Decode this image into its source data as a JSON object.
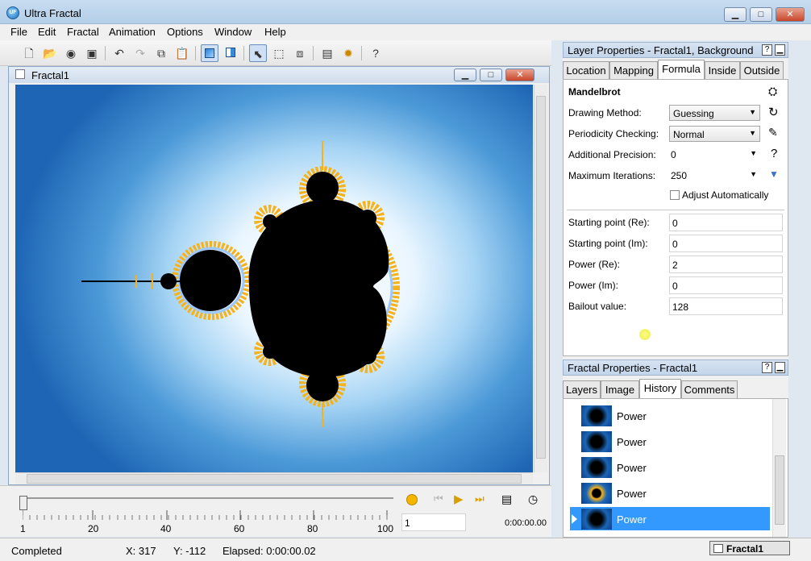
{
  "app": {
    "title": "Ultra Fractal"
  },
  "window_buttons": {
    "minimize": "▁",
    "maximize": "□",
    "close": "✕"
  },
  "menu": [
    "File",
    "Edit",
    "Fractal",
    "Animation",
    "Options",
    "Window",
    "Help"
  ],
  "toolbar": {
    "icons": [
      "new-file-icon",
      "open-folder-icon",
      "browse-icon",
      "save-icon",
      "undo-icon",
      "redo-icon",
      "copy-icon",
      "paste-icon",
      "fullscreen-view-icon",
      "split-view-icon",
      "select-tool-icon",
      "zoom-tool-icon",
      "move-tool-icon",
      "render-to-disk-icon",
      "gear-icon",
      "help-icon"
    ],
    "help_glyph": "?"
  },
  "document": {
    "title": "Fractal1"
  },
  "colors": {
    "accent": "#3399ff",
    "selected_row": "#3399ff",
    "fractal_inside": "#000000",
    "fractal_edge": "#f5b21b",
    "background_outer": "#1e66b5"
  },
  "animation": {
    "ticks": [
      "1",
      "20",
      "40",
      "60",
      "80",
      "100"
    ],
    "frame_value": "1",
    "time": "0:00:00.00"
  },
  "status": {
    "state": "Completed",
    "x_readout": "X: 317",
    "y_readout": "Y: -112",
    "elapsed": "Elapsed: 0:00:00.02",
    "taskbar_item": "Fractal1"
  },
  "layer_panel": {
    "title": "Layer Properties - Fractal1, Background",
    "tabs": [
      "Location",
      "Mapping",
      "Formula",
      "Inside",
      "Outside"
    ],
    "active_tab": "Formula",
    "formula_name": "Mandelbrot",
    "rows": [
      {
        "label": "Drawing Method:",
        "value": "Guessing"
      },
      {
        "label": "Periodicity Checking:",
        "value": "Normal"
      },
      {
        "label": "Additional Precision:",
        "value": "0"
      },
      {
        "label": "Maximum Iterations:",
        "value": "250"
      }
    ],
    "adjust_label": "Adjust Automatically",
    "help_glyph": "?",
    "params": [
      {
        "label": "Starting point (Re):",
        "value": "0"
      },
      {
        "label": "Starting point (Im):",
        "value": "0"
      },
      {
        "label": "Power (Re):",
        "value": "2"
      },
      {
        "label": "Power (Im):",
        "value": "0"
      },
      {
        "label": "Bailout value:",
        "value": "128"
      }
    ]
  },
  "fractal_panel": {
    "title": "Fractal Properties - Fractal1",
    "tabs": [
      "Layers",
      "Image",
      "History",
      "Comments"
    ],
    "active_tab": "History",
    "history": [
      "Power",
      "Power",
      "Power",
      "Power",
      "Power"
    ],
    "selected_index": 4
  }
}
